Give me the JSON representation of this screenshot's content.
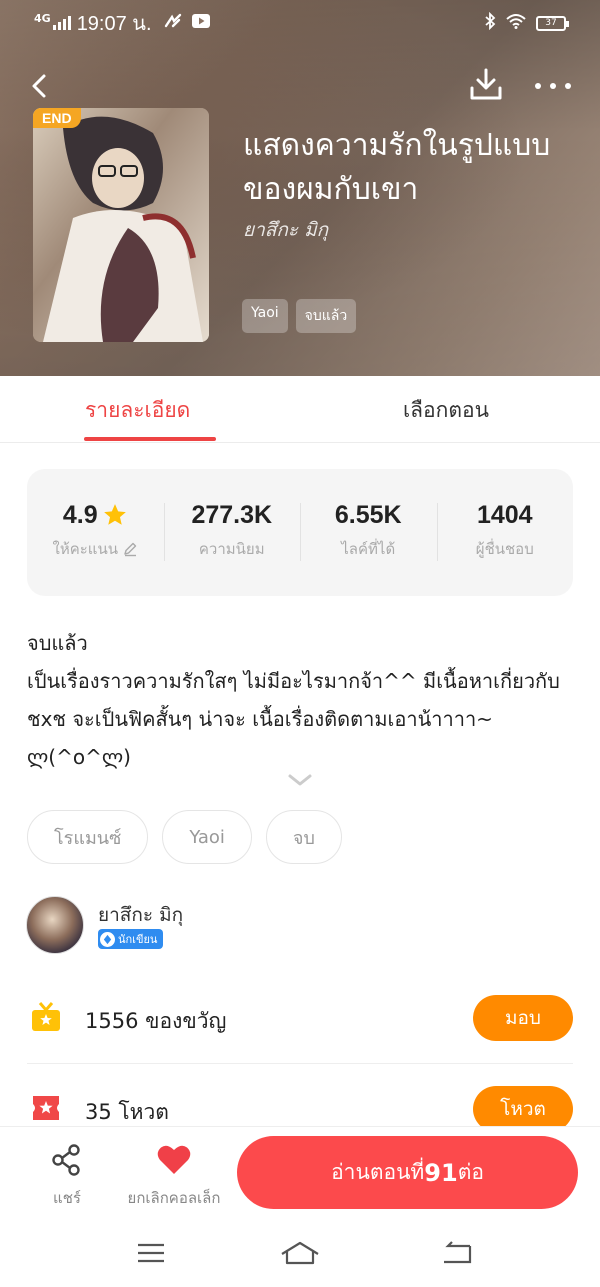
{
  "status_bar": {
    "network": "4G",
    "time": "19:07 น.",
    "battery": "37"
  },
  "hero": {
    "badge": "END",
    "title": "แสดงความรักในรูปแบบของผมกับเขา",
    "author": "ยาสึกะ มิกุ",
    "tags": [
      "Yaoi",
      "จบแล้ว"
    ],
    "icons": [
      "back-arrow-icon",
      "download-icon",
      "more-icon"
    ]
  },
  "tabs": {
    "detail": "รายละเอียด",
    "episodes": "เลือกตอน",
    "active": "detail"
  },
  "stats": {
    "rating": {
      "value": "4.9",
      "label": "ให้คะแนน"
    },
    "popularity": {
      "value": "277.3K",
      "label": "ความนิยม"
    },
    "likes": {
      "value": "6.55K",
      "label": "ไลค์ที่ได้"
    },
    "fans": {
      "value": "1404",
      "label": "ผู้ชื่นชอบ"
    }
  },
  "description": {
    "status": "จบแล้ว",
    "text": "เป็นเรื่องราวความรักใสๆ ไม่มีอะไรมากจ้า^^ มีเนื้อหาเกี่ยวกับ ชxช จะเป็นฟิคสั้นๆ น่าจะ เนื้อเรื่องติดตามเอาน้าาาา~ ლ(^o^ლ)"
  },
  "genre_tags": [
    "โรแมนซ์",
    "Yaoi",
    "จบ"
  ],
  "author": {
    "name": "ยาสึกะ มิกุ",
    "badge": "นักเขียน"
  },
  "gifts": {
    "text": "1556 ของขวัญ",
    "button": "มอบ"
  },
  "votes": {
    "text": "35 โหวต",
    "button": "โหวต"
  },
  "bottom_bar": {
    "share": "แชร์",
    "uncollect": "ยกเลิกคอลเล็ก",
    "read_prefix": "อ่านตอนที่",
    "read_number": "91",
    "read_suffix": "ต่อ"
  },
  "colors": {
    "accent_red": "#ee4444",
    "read_button": "#fc4a4c",
    "orange_button": "#ff8a00",
    "end_badge": "#f5a623",
    "star": "#ffc107",
    "writer_badge": "#2f8cf0"
  }
}
